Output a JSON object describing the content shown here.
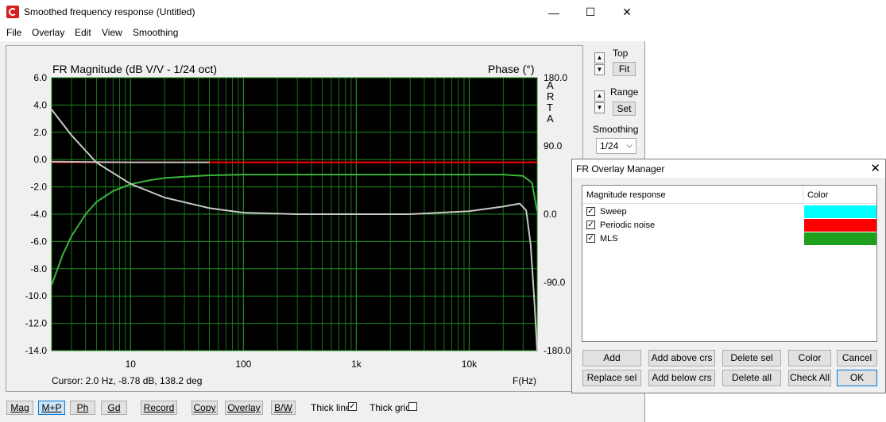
{
  "window": {
    "title": "Smoothed frequency response (Untitled)",
    "controls": [
      "—",
      "☐",
      "✕"
    ]
  },
  "menu": [
    "File",
    "Overlay",
    "Edit",
    "View",
    "Smoothing"
  ],
  "plot": {
    "title_left": "FR Magnitude (dB V/V - 1/24 oct)",
    "title_right": "Phase (°)",
    "brand": [
      "A",
      "R",
      "T",
      "A"
    ],
    "cursor": "Cursor: 2.0 Hz, -8.78 dB, 138.2 deg",
    "xunit": "F(Hz)"
  },
  "side": {
    "top_label": "Top",
    "fit_label": "Fit",
    "range_label": "Range",
    "set_label": "Set",
    "smoothing_label": "Smoothing",
    "smoothing_value": "1/24",
    "spin_up": "▲",
    "spin_down": "▼"
  },
  "bottom": {
    "buttons": [
      "Mag",
      "M+P",
      "Ph",
      "Gd",
      "Record",
      "Copy",
      "Overlay",
      "B/W"
    ],
    "thick_line_label": "Thick line",
    "thick_line_checked": "✓",
    "thick_grid_label": "Thick grid"
  },
  "overlay_manager": {
    "title": "FR Overlay Manager",
    "close": "✕",
    "col_response": "Magnitude response",
    "col_color": "Color",
    "items": [
      {
        "label": "Sweep",
        "color": "#00ffff",
        "check": "✓"
      },
      {
        "label": "Periodic noise",
        "color": "#ff0000",
        "check": "✓"
      },
      {
        "label": "MLS",
        "color": "#1ea01e",
        "check": "✓"
      }
    ],
    "buttons_row1": [
      "Add",
      "Add above crs",
      "Delete sel",
      "Color",
      "Cancel"
    ],
    "buttons_row2": [
      "Replace sel",
      "Add below crs",
      "Delete all",
      "Check All",
      "OK"
    ]
  },
  "chart_data": {
    "type": "line",
    "x_scale": "log",
    "xlim": [
      2,
      40000
    ],
    "ylim": [
      -14,
      6
    ],
    "y2lim": [
      -180,
      180
    ],
    "x_ticks": [
      10,
      100,
      1000,
      10000
    ],
    "x_tick_labels": [
      "10",
      "100",
      "1k",
      "10k"
    ],
    "y_ticks": [
      6,
      4,
      2,
      0,
      -2,
      -4,
      -6,
      -8,
      -10,
      -12,
      -14
    ],
    "y_tick_labels": [
      "6.0",
      "4.0",
      "2.0",
      "0.0",
      "-2.0",
      "-4.0",
      "-6.0",
      "-8.0",
      "-10.0",
      "-12.0",
      "-14.0"
    ],
    "y2_ticks": [
      180,
      90,
      0,
      -90,
      -180
    ],
    "y2_tick_labels": [
      "180.0",
      "90.0",
      "0.0",
      "-90.0",
      "-180.0"
    ],
    "grid": true,
    "colors": {
      "background": "#000000",
      "grid": "#1e8c1e"
    },
    "series": [
      {
        "name": "Periodic noise",
        "axis": "y",
        "color": "#ff0000",
        "x": [
          2,
          10,
          100,
          1000,
          10000,
          40000
        ],
        "y": [
          -0.2,
          -0.2,
          -0.2,
          -0.2,
          -0.2,
          -0.2
        ]
      },
      {
        "axis": "y",
        "color": "#c0c0c0",
        "x": [
          2,
          5,
          10,
          50
        ],
        "y": [
          -0.15,
          -0.18,
          -0.2,
          -0.2
        ]
      },
      {
        "name": "MLS",
        "axis": "y",
        "color": "#3cb43c",
        "x": [
          2,
          2.5,
          3,
          4,
          5,
          7,
          10,
          15,
          20,
          30,
          50,
          100,
          300,
          1000,
          3000,
          10000,
          20000,
          30000,
          36000,
          40000
        ],
        "y": [
          -9.2,
          -7.0,
          -5.6,
          -4.0,
          -3.1,
          -2.3,
          -1.8,
          -1.5,
          -1.35,
          -1.25,
          -1.15,
          -1.1,
          -1.1,
          -1.1,
          -1.1,
          -1.1,
          -1.1,
          -1.2,
          -1.7,
          -3.8
        ]
      },
      {
        "axis": "y2",
        "color": "#c8c8c8",
        "x": [
          2,
          3,
          5,
          10,
          20,
          50,
          100,
          300,
          1000,
          3000,
          10000,
          20000,
          28000,
          32000,
          35000,
          38000,
          40000
        ],
        "y": [
          138,
          104,
          68,
          40,
          22,
          8,
          2,
          0,
          0,
          0,
          4,
          10,
          14,
          5,
          -40,
          -120,
          -180
        ]
      }
    ]
  }
}
